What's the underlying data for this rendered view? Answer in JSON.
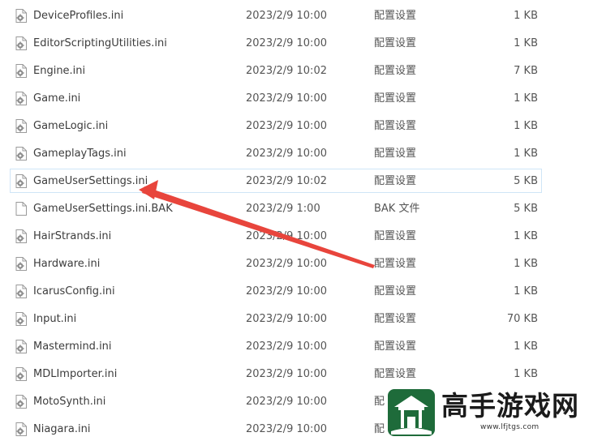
{
  "files": [
    {
      "name": "DeviceProfiles.ini",
      "date": "2023/2/9 10:00",
      "type": "配置设置",
      "size": "1 KB",
      "icon": "ini-settings-icon"
    },
    {
      "name": "EditorScriptingUtilities.ini",
      "date": "2023/2/9 10:00",
      "type": "配置设置",
      "size": "1 KB",
      "icon": "ini-settings-icon"
    },
    {
      "name": "Engine.ini",
      "date": "2023/2/9 10:02",
      "type": "配置设置",
      "size": "7 KB",
      "icon": "ini-settings-icon"
    },
    {
      "name": "Game.ini",
      "date": "2023/2/9 10:00",
      "type": "配置设置",
      "size": "1 KB",
      "icon": "ini-settings-icon"
    },
    {
      "name": "GameLogic.ini",
      "date": "2023/2/9 10:00",
      "type": "配置设置",
      "size": "1 KB",
      "icon": "ini-settings-icon"
    },
    {
      "name": "GameplayTags.ini",
      "date": "2023/2/9 10:00",
      "type": "配置设置",
      "size": "1 KB",
      "icon": "ini-settings-icon"
    },
    {
      "name": "GameUserSettings.ini",
      "date": "2023/2/9 10:02",
      "type": "配置设置",
      "size": "5 KB",
      "icon": "ini-settings-icon",
      "selected": true
    },
    {
      "name": "GameUserSettings.ini.BAK",
      "date": "2023/2/9 1:00",
      "type": "BAK 文件",
      "size": "5 KB",
      "icon": "blank-file-icon"
    },
    {
      "name": "HairStrands.ini",
      "date": "2023/2/9 10:00",
      "type": "配置设置",
      "size": "1 KB",
      "icon": "ini-settings-icon"
    },
    {
      "name": "Hardware.ini",
      "date": "2023/2/9 10:00",
      "type": "配置设置",
      "size": "1 KB",
      "icon": "ini-settings-icon"
    },
    {
      "name": "IcarusConfig.ini",
      "date": "2023/2/9 10:00",
      "type": "配置设置",
      "size": "1 KB",
      "icon": "ini-settings-icon"
    },
    {
      "name": "Input.ini",
      "date": "2023/2/9 10:00",
      "type": "配置设置",
      "size": "70 KB",
      "icon": "ini-settings-icon"
    },
    {
      "name": "Mastermind.ini",
      "date": "2023/2/9 10:00",
      "type": "配置设置",
      "size": "1 KB",
      "icon": "ini-settings-icon"
    },
    {
      "name": "MDLImporter.ini",
      "date": "2023/2/9 10:00",
      "type": "配置设置",
      "size": "1 KB",
      "icon": "ini-settings-icon"
    },
    {
      "name": "MotoSynth.ini",
      "date": "2023/2/9 10:00",
      "type": "配",
      "size": "",
      "icon": "ini-settings-icon"
    },
    {
      "name": "Niagara.ini",
      "date": "2023/2/9 10:00",
      "type": "配",
      "size": "",
      "icon": "ini-settings-icon"
    }
  ],
  "annotation": {
    "color": "#e8453c",
    "target": "GameUserSettings.ini"
  },
  "watermark": {
    "text": "高手游戏网",
    "url": "www.lfjtgs.com",
    "color": "#1e6b3a"
  }
}
